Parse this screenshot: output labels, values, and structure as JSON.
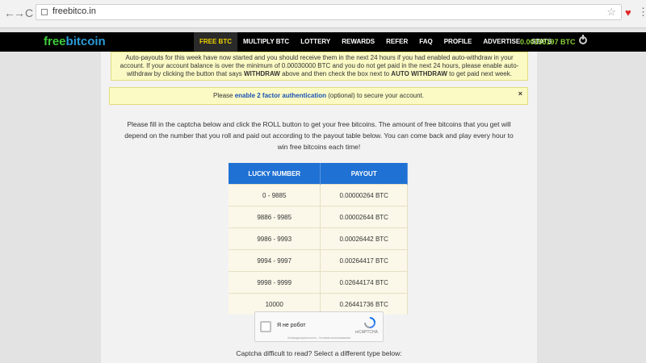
{
  "browser": {
    "url": "freebitco.in",
    "back_glyph": "←",
    "forward_glyph": "→",
    "reload_glyph": "C",
    "star_glyph": "☆",
    "menu_glyph": "⋮",
    "ext_glyph": "♥"
  },
  "site": {
    "logo_a": "free",
    "logo_b": "bitcoin",
    "nav": [
      {
        "label": "FREE BTC",
        "active": true
      },
      {
        "label": "MULTIPLY BTC"
      },
      {
        "label": "LOTTERY"
      },
      {
        "label": "REWARDS"
      },
      {
        "label": "REFER"
      },
      {
        "label": "FAQ"
      },
      {
        "label": "PROFILE"
      },
      {
        "label": "ADVERTISE"
      },
      {
        "label": "STATS"
      }
    ],
    "balance": "0.00155197 BTC"
  },
  "notice1": {
    "line1": "Auto-payouts for this week have now started and you should receive them in the next 24 hours if you had enabled auto-withdraw in your",
    "line2": "account. If your account balance is over the minimum of 0.00030000 BTC and you do not get paid in the next 24 hours, please enable auto-",
    "line3_a": "withdraw by clicking the button that says ",
    "line3_b": "WITHDRAW",
    "line3_c": " above and then check the box next to ",
    "line3_d": "AUTO WITHDRAW",
    "line3_e": " to get paid next week."
  },
  "notice2": {
    "pre": "Please ",
    "link": "enable 2 factor authentication",
    "post": " (optional) to secure your account.",
    "close": "×"
  },
  "intro": {
    "line1": "Please fill in the captcha below and click the ROLL button to get your free bitcoins. The amount of free bitcoins that you get will",
    "line2": "depend on the number that you roll and paid out according to the payout table below. You can come back and play every hour to",
    "line3": "win free bitcoins each time!"
  },
  "payout_table": {
    "headers": [
      "LUCKY NUMBER",
      "PAYOUT"
    ],
    "rows": [
      [
        "0 - 9885",
        "0.00000264 BTC"
      ],
      [
        "9886 - 9985",
        "0.00002644 BTC"
      ],
      [
        "9986 - 9993",
        "0.00026442 BTC"
      ],
      [
        "9994 - 9997",
        "0.00264417 BTC"
      ],
      [
        "9998 - 9999",
        "0.02644174 BTC"
      ],
      [
        "10000",
        "0.26441736 BTC"
      ]
    ]
  },
  "captcha": {
    "label": "Я не робот",
    "brand": "reCAPTCHA",
    "terms": "Конфиденциальность - Условия использования"
  },
  "captcha_help": "Captcha difficult to read? Select a different type below:"
}
